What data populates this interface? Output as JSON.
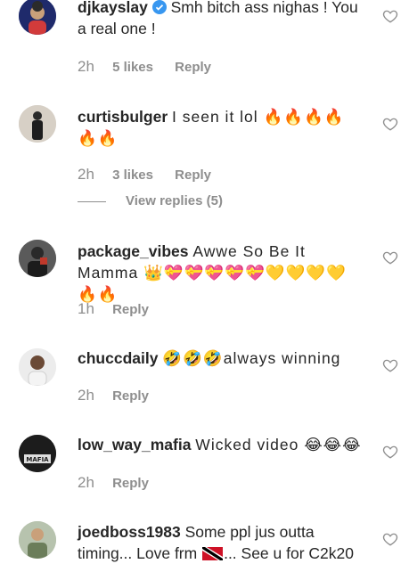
{
  "comments": [
    {
      "username": "djkayslay",
      "verified": true,
      "text": "Smh bitch ass nighas ! You a real one !",
      "time": "2h",
      "likes": "5 likes",
      "reply": "Reply"
    },
    {
      "username": "curtisbulger",
      "text": "I seen it lol 🔥🔥🔥🔥🔥🔥",
      "time": "2h",
      "likes": "3 likes",
      "reply": "Reply",
      "view_replies": "View replies (5)"
    },
    {
      "username": "package_vibes",
      "text": "Awwe So Be It Mamma 👑💝💝💝💝💝💛💛💛💛🔥🔥",
      "time": "1h",
      "reply": "Reply"
    },
    {
      "username": "chuccdaily",
      "text": "🤣🤣🤣always winning",
      "time": "2h",
      "reply": "Reply"
    },
    {
      "username": "low_way_mafia",
      "text": "Wicked video 😂😂😂",
      "time": "2h",
      "reply": "Reply",
      "avatar_text": "MAFIA"
    },
    {
      "username": "joedboss1983",
      "text_before_flag": "Some ppl jus outta timing... Love frm ",
      "text_after_flag": "... See u for C2k20",
      "flag_name": "trinidad-and-tobago-flag"
    }
  ],
  "colors": {
    "text": "#262626",
    "meta": "#8e8e8e",
    "verified": "#3897f0",
    "heart_outline": "#8e8e8e"
  }
}
